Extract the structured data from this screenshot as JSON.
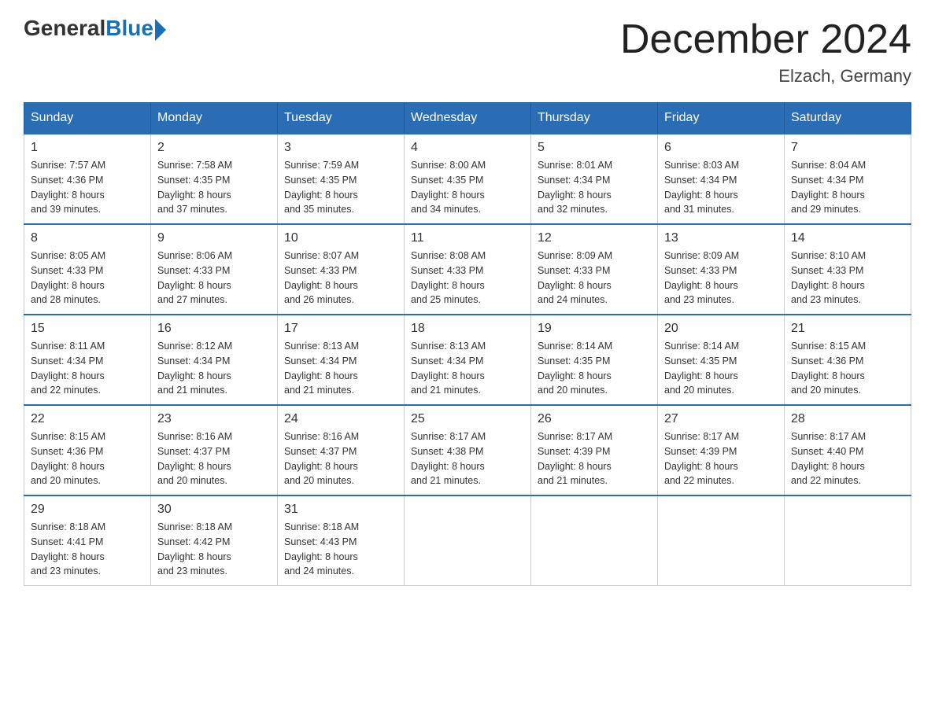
{
  "header": {
    "logo": {
      "general": "General",
      "blue": "Blue"
    },
    "title": "December 2024",
    "location": "Elzach, Germany"
  },
  "weekdays": [
    "Sunday",
    "Monday",
    "Tuesday",
    "Wednesday",
    "Thursday",
    "Friday",
    "Saturday"
  ],
  "weeks": [
    [
      {
        "day": "1",
        "sunrise": "7:57 AM",
        "sunset": "4:36 PM",
        "daylight": "8 hours and 39 minutes."
      },
      {
        "day": "2",
        "sunrise": "7:58 AM",
        "sunset": "4:35 PM",
        "daylight": "8 hours and 37 minutes."
      },
      {
        "day": "3",
        "sunrise": "7:59 AM",
        "sunset": "4:35 PM",
        "daylight": "8 hours and 35 minutes."
      },
      {
        "day": "4",
        "sunrise": "8:00 AM",
        "sunset": "4:35 PM",
        "daylight": "8 hours and 34 minutes."
      },
      {
        "day": "5",
        "sunrise": "8:01 AM",
        "sunset": "4:34 PM",
        "daylight": "8 hours and 32 minutes."
      },
      {
        "day": "6",
        "sunrise": "8:03 AM",
        "sunset": "4:34 PM",
        "daylight": "8 hours and 31 minutes."
      },
      {
        "day": "7",
        "sunrise": "8:04 AM",
        "sunset": "4:34 PM",
        "daylight": "8 hours and 29 minutes."
      }
    ],
    [
      {
        "day": "8",
        "sunrise": "8:05 AM",
        "sunset": "4:33 PM",
        "daylight": "8 hours and 28 minutes."
      },
      {
        "day": "9",
        "sunrise": "8:06 AM",
        "sunset": "4:33 PM",
        "daylight": "8 hours and 27 minutes."
      },
      {
        "day": "10",
        "sunrise": "8:07 AM",
        "sunset": "4:33 PM",
        "daylight": "8 hours and 26 minutes."
      },
      {
        "day": "11",
        "sunrise": "8:08 AM",
        "sunset": "4:33 PM",
        "daylight": "8 hours and 25 minutes."
      },
      {
        "day": "12",
        "sunrise": "8:09 AM",
        "sunset": "4:33 PM",
        "daylight": "8 hours and 24 minutes."
      },
      {
        "day": "13",
        "sunrise": "8:09 AM",
        "sunset": "4:33 PM",
        "daylight": "8 hours and 23 minutes."
      },
      {
        "day": "14",
        "sunrise": "8:10 AM",
        "sunset": "4:33 PM",
        "daylight": "8 hours and 23 minutes."
      }
    ],
    [
      {
        "day": "15",
        "sunrise": "8:11 AM",
        "sunset": "4:34 PM",
        "daylight": "8 hours and 22 minutes."
      },
      {
        "day": "16",
        "sunrise": "8:12 AM",
        "sunset": "4:34 PM",
        "daylight": "8 hours and 21 minutes."
      },
      {
        "day": "17",
        "sunrise": "8:13 AM",
        "sunset": "4:34 PM",
        "daylight": "8 hours and 21 minutes."
      },
      {
        "day": "18",
        "sunrise": "8:13 AM",
        "sunset": "4:34 PM",
        "daylight": "8 hours and 21 minutes."
      },
      {
        "day": "19",
        "sunrise": "8:14 AM",
        "sunset": "4:35 PM",
        "daylight": "8 hours and 20 minutes."
      },
      {
        "day": "20",
        "sunrise": "8:14 AM",
        "sunset": "4:35 PM",
        "daylight": "8 hours and 20 minutes."
      },
      {
        "day": "21",
        "sunrise": "8:15 AM",
        "sunset": "4:36 PM",
        "daylight": "8 hours and 20 minutes."
      }
    ],
    [
      {
        "day": "22",
        "sunrise": "8:15 AM",
        "sunset": "4:36 PM",
        "daylight": "8 hours and 20 minutes."
      },
      {
        "day": "23",
        "sunrise": "8:16 AM",
        "sunset": "4:37 PM",
        "daylight": "8 hours and 20 minutes."
      },
      {
        "day": "24",
        "sunrise": "8:16 AM",
        "sunset": "4:37 PM",
        "daylight": "8 hours and 20 minutes."
      },
      {
        "day": "25",
        "sunrise": "8:17 AM",
        "sunset": "4:38 PM",
        "daylight": "8 hours and 21 minutes."
      },
      {
        "day": "26",
        "sunrise": "8:17 AM",
        "sunset": "4:39 PM",
        "daylight": "8 hours and 21 minutes."
      },
      {
        "day": "27",
        "sunrise": "8:17 AM",
        "sunset": "4:39 PM",
        "daylight": "8 hours and 22 minutes."
      },
      {
        "day": "28",
        "sunrise": "8:17 AM",
        "sunset": "4:40 PM",
        "daylight": "8 hours and 22 minutes."
      }
    ],
    [
      {
        "day": "29",
        "sunrise": "8:18 AM",
        "sunset": "4:41 PM",
        "daylight": "8 hours and 23 minutes."
      },
      {
        "day": "30",
        "sunrise": "8:18 AM",
        "sunset": "4:42 PM",
        "daylight": "8 hours and 23 minutes."
      },
      {
        "day": "31",
        "sunrise": "8:18 AM",
        "sunset": "4:43 PM",
        "daylight": "8 hours and 24 minutes."
      },
      null,
      null,
      null,
      null
    ]
  ],
  "labels": {
    "sunrise": "Sunrise:",
    "sunset": "Sunset:",
    "daylight": "Daylight:"
  }
}
